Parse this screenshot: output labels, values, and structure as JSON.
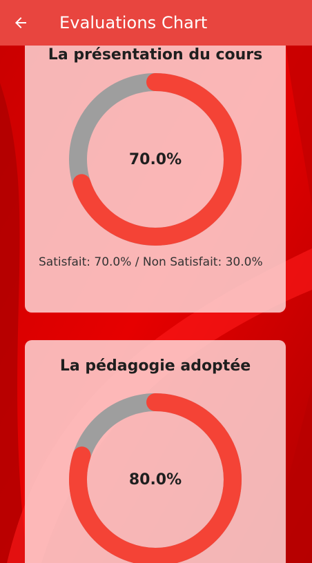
{
  "app_bar": {
    "back_icon": "arrow-left-icon",
    "title": "Evaluations Chart"
  },
  "colors": {
    "app_bar": "#e8453f",
    "satisfied": "#f44336",
    "not_satisfied": "#9e9e9e",
    "card": "#ffdede"
  },
  "evaluations": [
    {
      "title": "La présentation du cours",
      "satisfied_percent": 70.0,
      "percent_label": "70.0%",
      "summary": "Satisfait: 70.0% / Non Satisfait: 30.0%"
    },
    {
      "title": "La pédagogie adoptée",
      "satisfied_percent": 80.0,
      "percent_label": "80.0%"
    }
  ]
}
